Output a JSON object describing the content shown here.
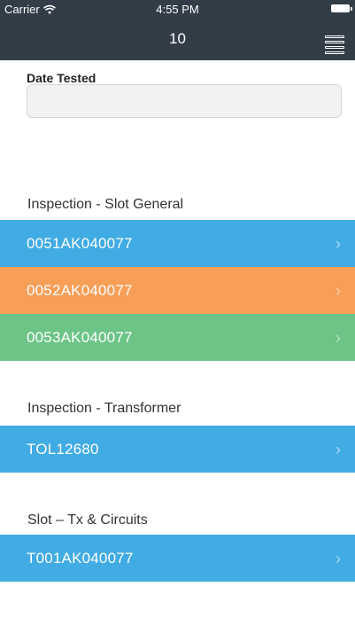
{
  "status_bar": {
    "carrier": "Carrier",
    "time": "4:55 PM"
  },
  "nav": {
    "title": "10",
    "menu_icon": "hamburger-icon"
  },
  "form": {
    "date_tested_label": "Date Tested",
    "date_tested_value": ""
  },
  "sections": [
    {
      "title": "Inspection - Slot General",
      "items": [
        {
          "label": "0051AK040077",
          "color": "#41abe3"
        },
        {
          "label": "0052AK040077",
          "color": "#f79e57"
        },
        {
          "label": "0053AK040077",
          "color": "#6cc487"
        }
      ]
    },
    {
      "title": "Inspection - Transformer",
      "items": [
        {
          "label": "TOL12680",
          "color": "#41abe3"
        }
      ]
    },
    {
      "title": "Slot – Tx & Circuits",
      "items": [
        {
          "label": "T001AK040077",
          "color": "#41abe3"
        }
      ]
    }
  ],
  "colors": {
    "header_bg": "#323d47",
    "blue": "#41abe3",
    "orange": "#f79e57",
    "green": "#6cc487"
  }
}
